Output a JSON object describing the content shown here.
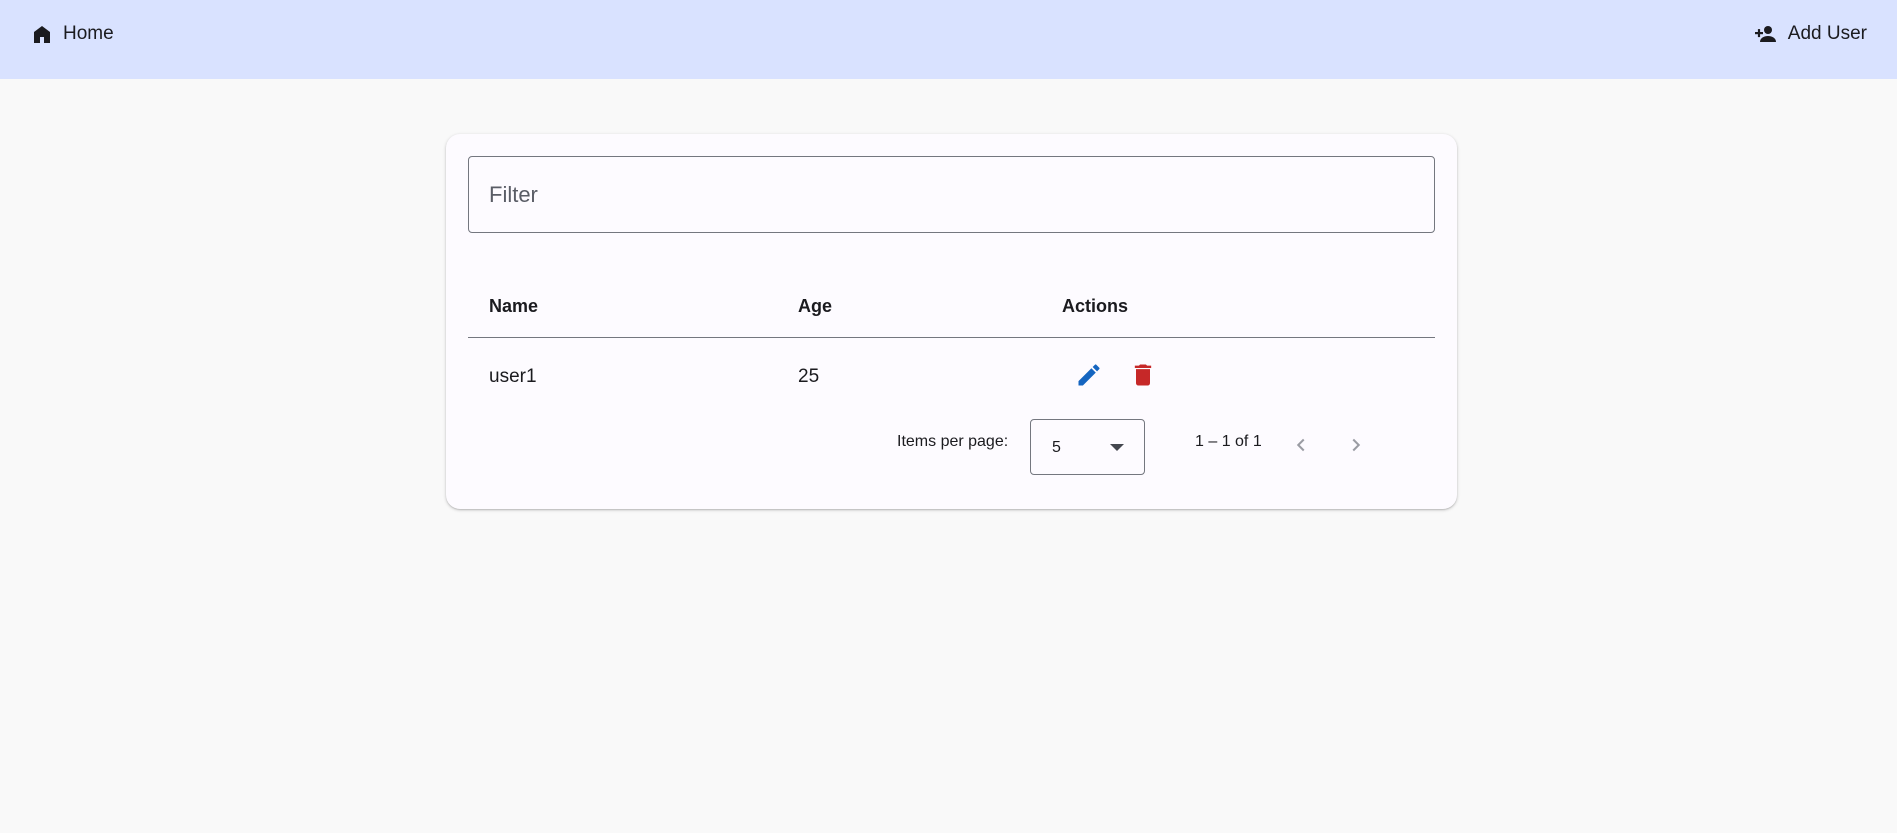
{
  "header": {
    "home_label": "Home",
    "home_icon": "home-icon",
    "add_user_label": "Add User",
    "add_user_icon": "person-add-icon"
  },
  "filter": {
    "placeholder": "Filter",
    "value": ""
  },
  "table": {
    "columns": [
      "Name",
      "Age",
      "Actions"
    ],
    "rows": [
      {
        "name": "user1",
        "age": "25",
        "actions": [
          "edit-icon",
          "delete-icon"
        ]
      }
    ]
  },
  "paginator": {
    "items_per_page_label": "Items per page:",
    "page_size": "5",
    "range_label": "1 – 1 of 1",
    "prev_icon": "chevron-left-icon",
    "next_icon": "chevron-right-icon"
  },
  "colors": {
    "topbar": "#d9e2ff",
    "background": "#f9f9f9",
    "card": "#fdfbff",
    "edit": "#1565c0",
    "delete": "#c62828"
  }
}
